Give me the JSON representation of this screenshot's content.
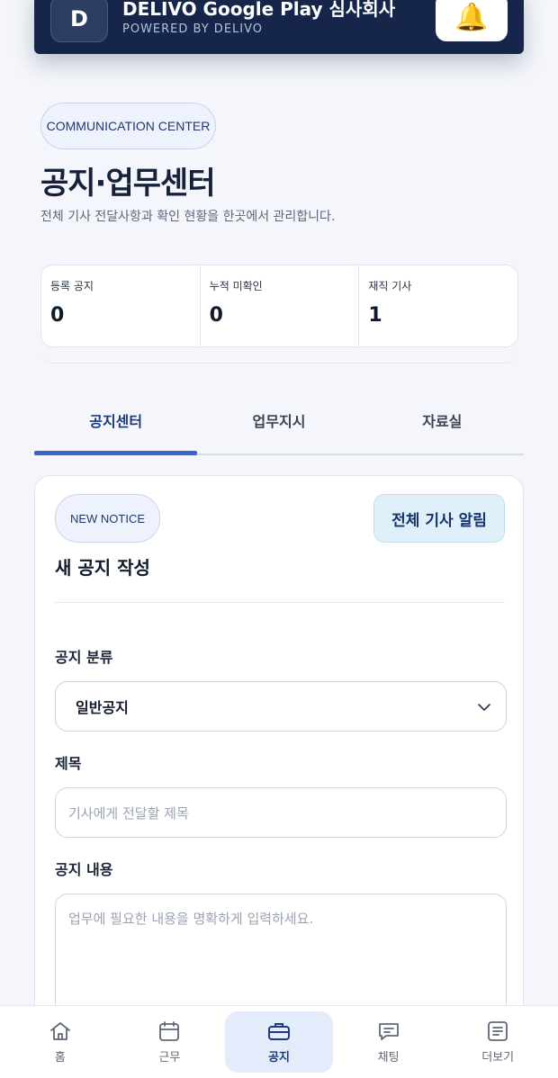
{
  "banner": {
    "logo_letter": "D",
    "title": "DELIVO Google Play 심사회사",
    "subtitle": "POWERED BY DELIVO",
    "bell_icon": "🔔"
  },
  "header": {
    "badge": "COMMUNICATION CENTER",
    "title": "공지·업무센터",
    "description": "전체 기사 전달사항과 확인 현황을 한곳에서 관리합니다."
  },
  "stats": [
    {
      "label": "등록 공지",
      "value": "0"
    },
    {
      "label": "누적 미확인",
      "value": "0"
    },
    {
      "label": "재직 기사",
      "value": "1"
    }
  ],
  "tabs": [
    {
      "label": "공지센터",
      "active": true
    },
    {
      "label": "업무지시",
      "active": false
    },
    {
      "label": "자료실",
      "active": false
    }
  ],
  "form": {
    "badge": "NEW NOTICE",
    "alert_button": "전체 기사 알림",
    "title": "새 공지 작성",
    "category_label": "공지 분류",
    "category_value": "일반공지",
    "subject_label": "제목",
    "subject_placeholder": "기사에게 전달할 제목",
    "content_label": "공지 내용",
    "content_placeholder": "업무에 필요한 내용을 명확하게 입력하세요."
  },
  "bottom_nav": [
    {
      "label": "홈",
      "icon": "home-icon"
    },
    {
      "label": "근무",
      "icon": "calendar-icon"
    },
    {
      "label": "공지",
      "icon": "briefcase-icon",
      "active": true
    },
    {
      "label": "채팅",
      "icon": "chat-icon"
    },
    {
      "label": "더보기",
      "icon": "document-icon"
    }
  ]
}
